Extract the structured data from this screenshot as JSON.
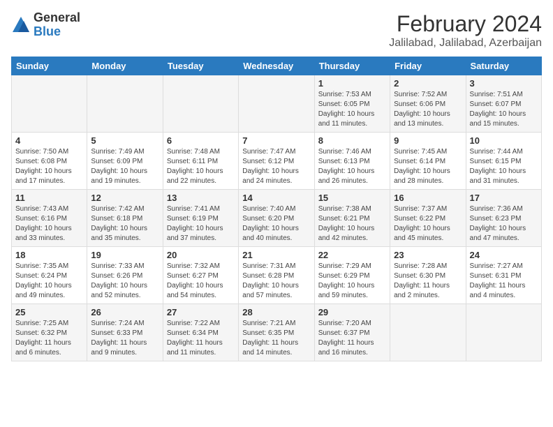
{
  "logo": {
    "general": "General",
    "blue": "Blue"
  },
  "title": "February 2024",
  "subtitle": "Jalilabad, Jalilabad, Azerbaijan",
  "columns": [
    "Sunday",
    "Monday",
    "Tuesday",
    "Wednesday",
    "Thursday",
    "Friday",
    "Saturday"
  ],
  "weeks": [
    [
      {
        "day": "",
        "info": ""
      },
      {
        "day": "",
        "info": ""
      },
      {
        "day": "",
        "info": ""
      },
      {
        "day": "",
        "info": ""
      },
      {
        "day": "1",
        "info": "Sunrise: 7:53 AM\nSunset: 6:05 PM\nDaylight: 10 hours\nand 11 minutes."
      },
      {
        "day": "2",
        "info": "Sunrise: 7:52 AM\nSunset: 6:06 PM\nDaylight: 10 hours\nand 13 minutes."
      },
      {
        "day": "3",
        "info": "Sunrise: 7:51 AM\nSunset: 6:07 PM\nDaylight: 10 hours\nand 15 minutes."
      }
    ],
    [
      {
        "day": "4",
        "info": "Sunrise: 7:50 AM\nSunset: 6:08 PM\nDaylight: 10 hours\nand 17 minutes."
      },
      {
        "day": "5",
        "info": "Sunrise: 7:49 AM\nSunset: 6:09 PM\nDaylight: 10 hours\nand 19 minutes."
      },
      {
        "day": "6",
        "info": "Sunrise: 7:48 AM\nSunset: 6:11 PM\nDaylight: 10 hours\nand 22 minutes."
      },
      {
        "day": "7",
        "info": "Sunrise: 7:47 AM\nSunset: 6:12 PM\nDaylight: 10 hours\nand 24 minutes."
      },
      {
        "day": "8",
        "info": "Sunrise: 7:46 AM\nSunset: 6:13 PM\nDaylight: 10 hours\nand 26 minutes."
      },
      {
        "day": "9",
        "info": "Sunrise: 7:45 AM\nSunset: 6:14 PM\nDaylight: 10 hours\nand 28 minutes."
      },
      {
        "day": "10",
        "info": "Sunrise: 7:44 AM\nSunset: 6:15 PM\nDaylight: 10 hours\nand 31 minutes."
      }
    ],
    [
      {
        "day": "11",
        "info": "Sunrise: 7:43 AM\nSunset: 6:16 PM\nDaylight: 10 hours\nand 33 minutes."
      },
      {
        "day": "12",
        "info": "Sunrise: 7:42 AM\nSunset: 6:18 PM\nDaylight: 10 hours\nand 35 minutes."
      },
      {
        "day": "13",
        "info": "Sunrise: 7:41 AM\nSunset: 6:19 PM\nDaylight: 10 hours\nand 37 minutes."
      },
      {
        "day": "14",
        "info": "Sunrise: 7:40 AM\nSunset: 6:20 PM\nDaylight: 10 hours\nand 40 minutes."
      },
      {
        "day": "15",
        "info": "Sunrise: 7:38 AM\nSunset: 6:21 PM\nDaylight: 10 hours\nand 42 minutes."
      },
      {
        "day": "16",
        "info": "Sunrise: 7:37 AM\nSunset: 6:22 PM\nDaylight: 10 hours\nand 45 minutes."
      },
      {
        "day": "17",
        "info": "Sunrise: 7:36 AM\nSunset: 6:23 PM\nDaylight: 10 hours\nand 47 minutes."
      }
    ],
    [
      {
        "day": "18",
        "info": "Sunrise: 7:35 AM\nSunset: 6:24 PM\nDaylight: 10 hours\nand 49 minutes."
      },
      {
        "day": "19",
        "info": "Sunrise: 7:33 AM\nSunset: 6:26 PM\nDaylight: 10 hours\nand 52 minutes."
      },
      {
        "day": "20",
        "info": "Sunrise: 7:32 AM\nSunset: 6:27 PM\nDaylight: 10 hours\nand 54 minutes."
      },
      {
        "day": "21",
        "info": "Sunrise: 7:31 AM\nSunset: 6:28 PM\nDaylight: 10 hours\nand 57 minutes."
      },
      {
        "day": "22",
        "info": "Sunrise: 7:29 AM\nSunset: 6:29 PM\nDaylight: 10 hours\nand 59 minutes."
      },
      {
        "day": "23",
        "info": "Sunrise: 7:28 AM\nSunset: 6:30 PM\nDaylight: 11 hours\nand 2 minutes."
      },
      {
        "day": "24",
        "info": "Sunrise: 7:27 AM\nSunset: 6:31 PM\nDaylight: 11 hours\nand 4 minutes."
      }
    ],
    [
      {
        "day": "25",
        "info": "Sunrise: 7:25 AM\nSunset: 6:32 PM\nDaylight: 11 hours\nand 6 minutes."
      },
      {
        "day": "26",
        "info": "Sunrise: 7:24 AM\nSunset: 6:33 PM\nDaylight: 11 hours\nand 9 minutes."
      },
      {
        "day": "27",
        "info": "Sunrise: 7:22 AM\nSunset: 6:34 PM\nDaylight: 11 hours\nand 11 minutes."
      },
      {
        "day": "28",
        "info": "Sunrise: 7:21 AM\nSunset: 6:35 PM\nDaylight: 11 hours\nand 14 minutes."
      },
      {
        "day": "29",
        "info": "Sunrise: 7:20 AM\nSunset: 6:37 PM\nDaylight: 11 hours\nand 16 minutes."
      },
      {
        "day": "",
        "info": ""
      },
      {
        "day": "",
        "info": ""
      }
    ]
  ]
}
